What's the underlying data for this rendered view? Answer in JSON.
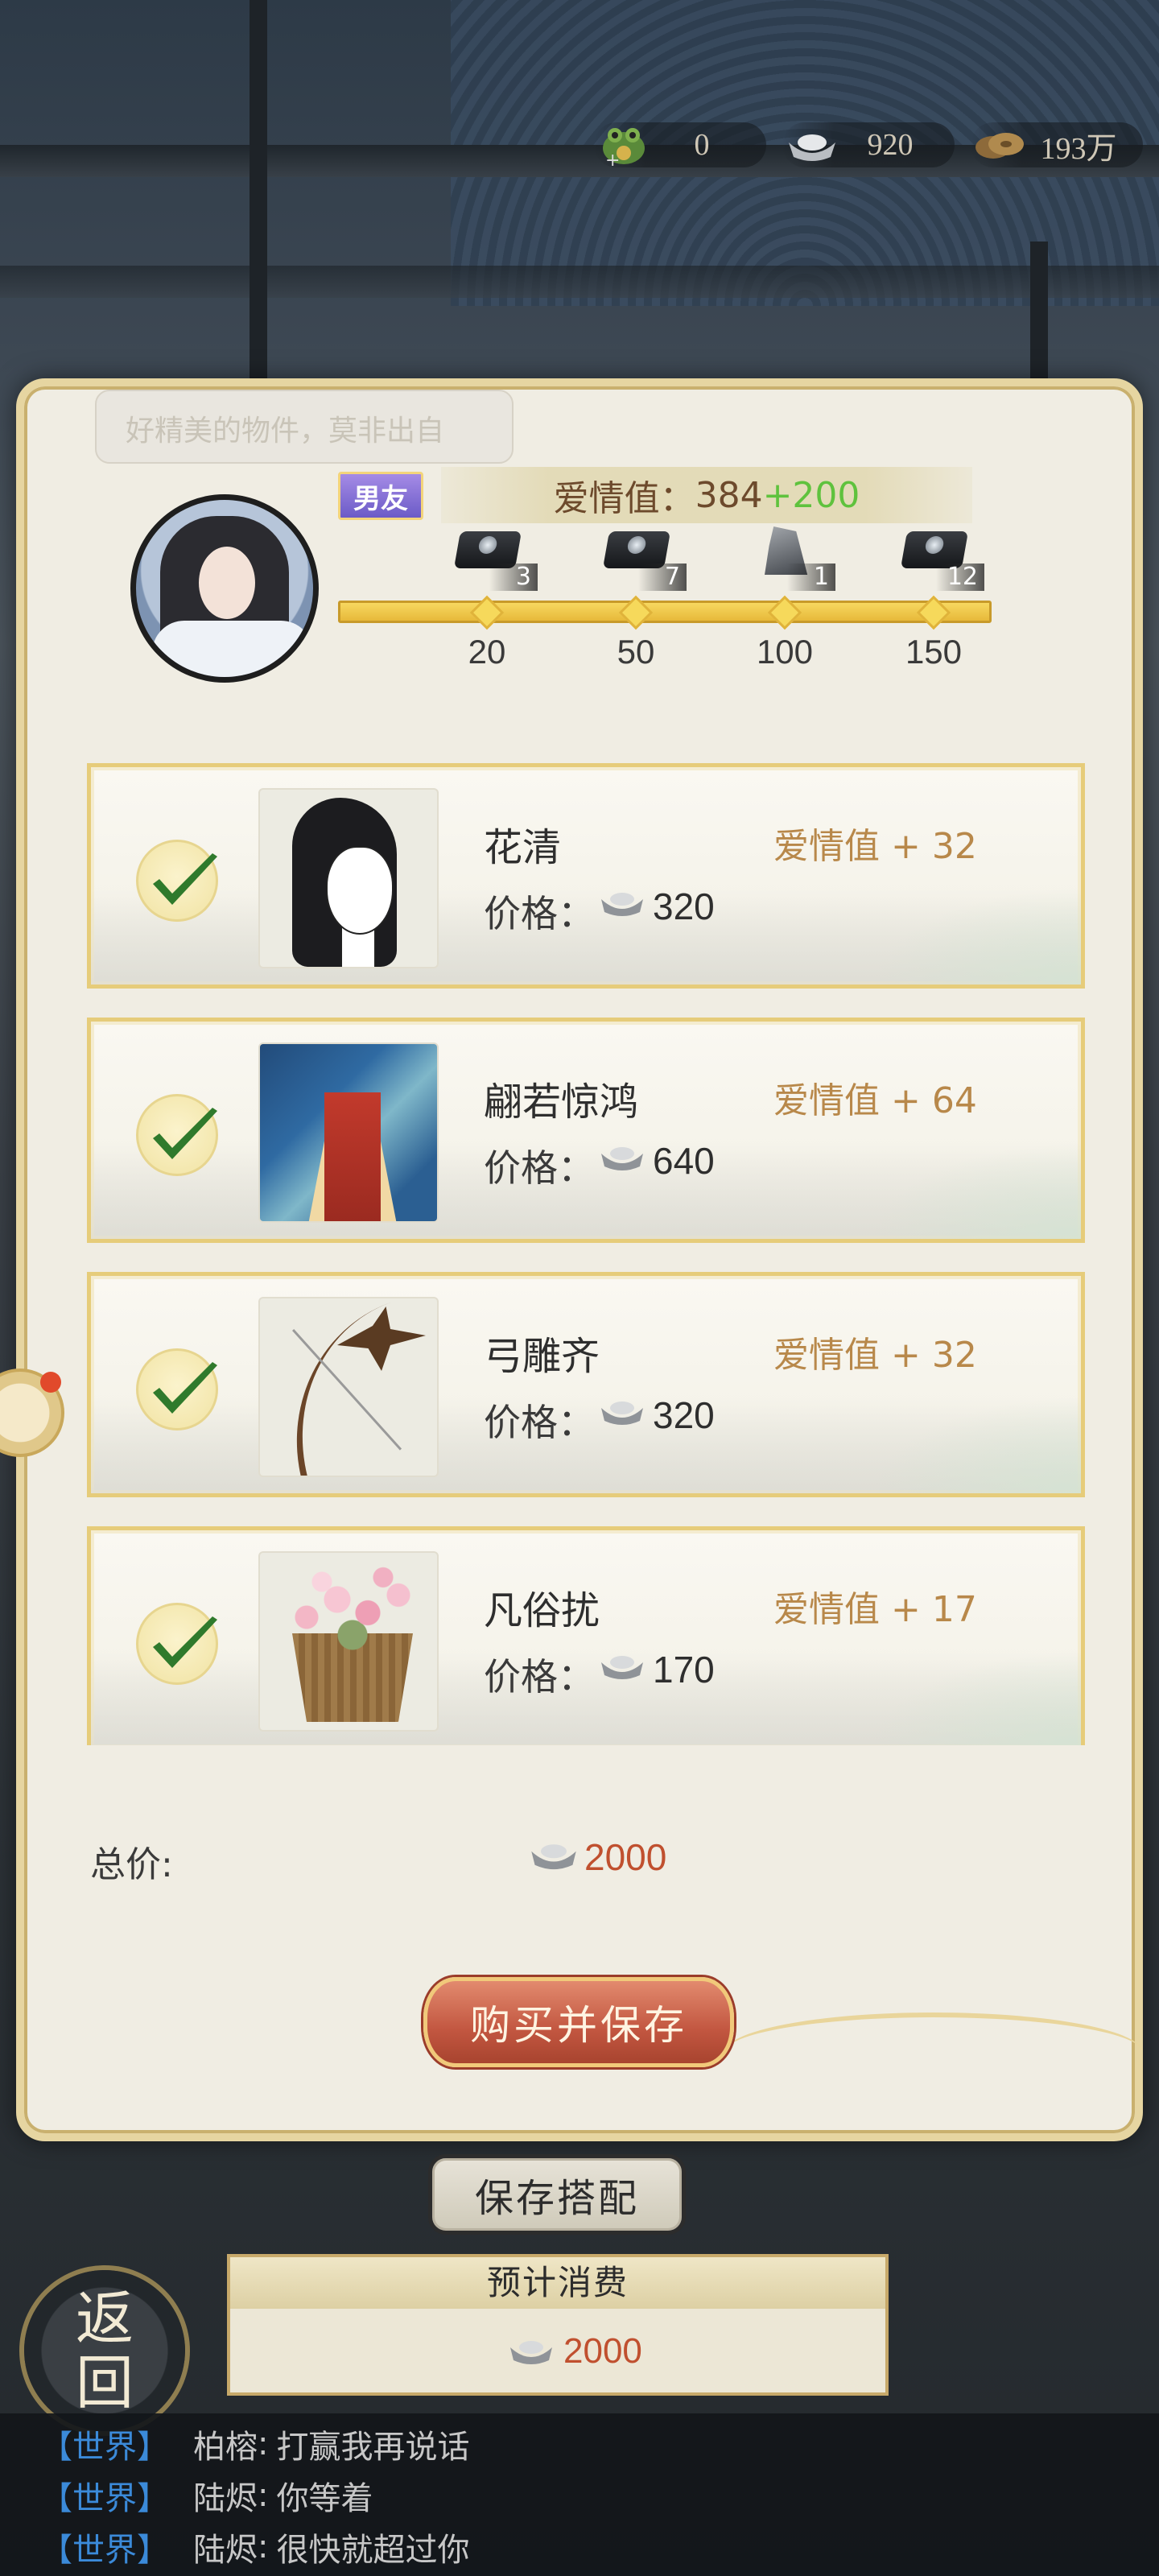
{
  "currency": [
    {
      "icon": "frog-coin-icon",
      "value": "0"
    },
    {
      "icon": "silver-ingot-icon",
      "value": "920"
    },
    {
      "icon": "copper-coin-icon",
      "value": "193万"
    }
  ],
  "dialog": {
    "speech_text": "好精美的物件，莫非出自",
    "badge": "男友",
    "love_label": "爱情值：",
    "love_value": "384",
    "love_bonus": "+200",
    "love_progress": 1.0,
    "milestones": [
      {
        "label": "20",
        "count": "3",
        "gift": "box"
      },
      {
        "label": "50",
        "count": "7",
        "gift": "box"
      },
      {
        "label": "100",
        "count": "1",
        "gift": "rock"
      },
      {
        "label": "150",
        "count": "12",
        "gift": "box"
      }
    ]
  },
  "items": [
    {
      "name": "花清",
      "price_label": "价格：",
      "price": "320",
      "love": "爱情值 + 32",
      "thumb": "hairstyle"
    },
    {
      "name": "翩若惊鸿",
      "price_label": "价格：",
      "price": "640",
      "love": "爱情值 + 64",
      "thumb": "robe"
    },
    {
      "name": "弓雕齐",
      "price_label": "价格：",
      "price": "320",
      "love": "爱情值 + 32",
      "thumb": "bow"
    },
    {
      "name": "凡俗扰",
      "price_label": "价格：",
      "price": "170",
      "love": "爱情值 + 17",
      "thumb": "basket"
    }
  ],
  "total": {
    "label": "总价:",
    "value": "2000"
  },
  "buy_button": "购买并保存",
  "save_outfit_button": "保存搭配",
  "estimate": {
    "title": "预计消费",
    "value": "2000"
  },
  "back_button": {
    "line1": "返",
    "line2": "回"
  },
  "chat": [
    {
      "channel": "【世界】",
      "user": "柏榕",
      "message": "打赢我再说话"
    },
    {
      "channel": "【世界】",
      "user": "陆烬",
      "message": "你等着"
    },
    {
      "channel": "【世界】",
      "user": "陆烬",
      "message": "很快就超过你"
    }
  ],
  "colors": {
    "accent_gold": "#e6cc7a",
    "price_red": "#c0502f",
    "love_gold": "#b8884a",
    "bonus_green": "#5fc23d"
  }
}
